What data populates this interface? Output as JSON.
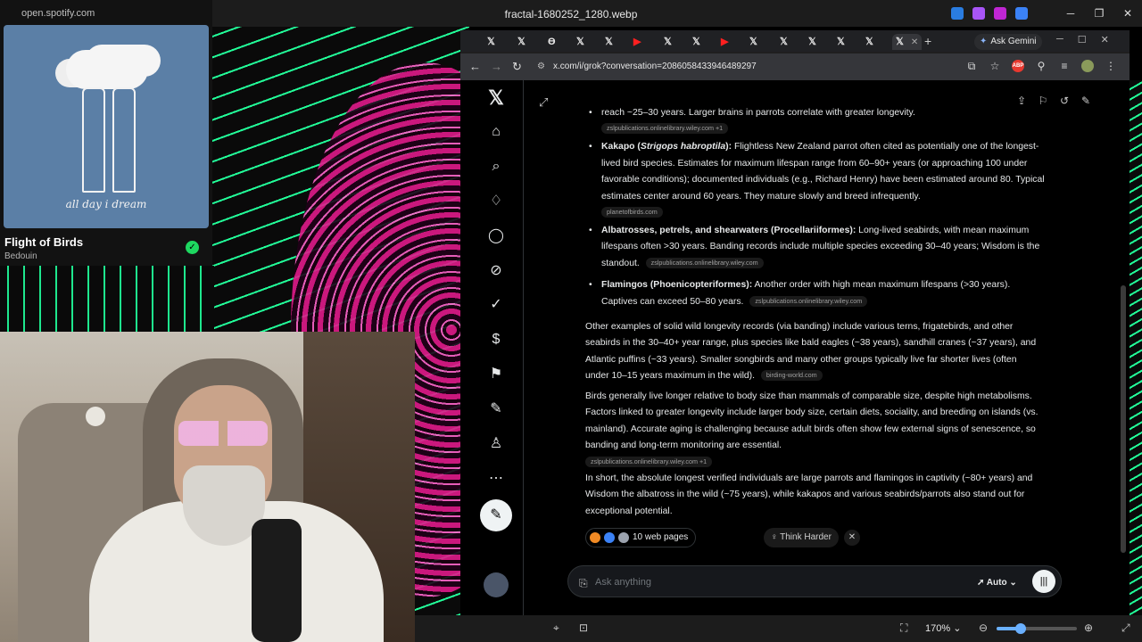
{
  "window": {
    "file_title": "fractal-1680252_1280.webp",
    "left_url": "open.spotify.com"
  },
  "spotify": {
    "album_caption": "all day i dream",
    "track": "Flight of Birds",
    "artist": "Bedouin"
  },
  "browser": {
    "tab_glyph": "𝕏",
    "tab_close": "✕",
    "ask_gemini": "Ask Gemini",
    "url": "x.com/i/grok?conversation=2086058433946489297"
  },
  "chat": {
    "frag_top": "reach ~25–30 years. Larger brains in parrots correlate with greater longevity.",
    "frag_top_src": "zslpublications.onlinelibrary.wiley.com +1",
    "b1_title": "Kakapo (",
    "b1_species": "Strigops habroptila",
    "b1_close": "):",
    "b1_text": " Flightless New Zealand parrot often cited as potentially one of the longest-lived bird species. Estimates for maximum lifespan range from 60–90+ years (or approaching 100 under favorable conditions); documented individuals (e.g., Richard Henry) have been estimated around 80. Typical estimates center around 60 years. They mature slowly and breed infrequently.",
    "b1_src": "planetofbirds.com",
    "b2_title": "Albatrosses, petrels, and shearwaters (Procellariiformes):",
    "b2_text": " Long-lived seabirds, with mean maximum lifespans often >30 years. Banding records include multiple species exceeding 30–40 years; Wisdom is the standout.",
    "b2_src": "zslpublications.onlinelibrary.wiley.com",
    "b3_title": "Flamingos (Phoenicopteriformes):",
    "b3_text": " Another order with high mean maximum lifespans (>30 years). Captives can exceed 50–80 years.",
    "b3_src": "zslpublications.onlinelibrary.wiley.com",
    "p1": "Other examples of solid wild longevity records (via banding) include various terns, frigatebirds, and other seabirds in the 30–40+ year range, plus species like bald eagles (~38 years), sandhill cranes (~37 years), and Atlantic puffins (~33 years). Smaller songbirds and many other groups typically live far shorter lives (often under 10–15 years maximum in the wild).",
    "p1_src": "birding-world.com",
    "p2": "Birds generally live longer relative to body size than mammals of comparable size, despite high metabolisms. Factors linked to greater longevity include larger body size, certain diets, sociality, and breeding on islands (vs. mainland). Accurate aging is challenging because adult birds often show few external signs of senescence, so banding and long-term monitoring are essential.",
    "p2_src": "zslpublications.onlinelibrary.wiley.com +1",
    "p3": "In short, the absolute longest verified individuals are large parrots and flamingos in captivity (~80+ years) and Wisdom the albatross in the wild (~75 years), while kakapos and various seabirds/parrots also stand out for exceptional potential.",
    "sources_label": "10 web pages",
    "think_label": "Think Harder",
    "ask_placeholder": "Ask anything",
    "mode_label": "Auto"
  },
  "viewer": {
    "zoom": "170%",
    "zoom_level": 0.3
  }
}
